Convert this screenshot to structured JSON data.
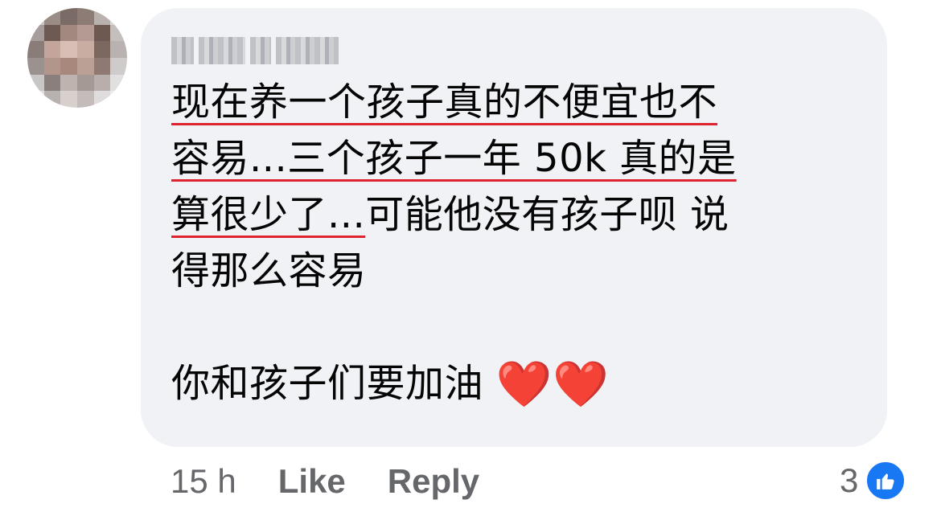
{
  "comment": {
    "lines": [
      "现在养一个孩子真的不便宜也不",
      "容易...三个孩子一年 50k 真的是",
      "算很少了...",
      "可能他没有孩子呗 说",
      "得那么容易",
      "你和孩子们要加油",
      "❤️❤️"
    ]
  },
  "footer": {
    "time": "15 h",
    "like_label": "Like",
    "reply_label": "Reply",
    "reaction_count": "3",
    "reaction_icon": "thumbs-up-icon"
  },
  "colors": {
    "bubble": "#f0f2f5",
    "underline": "#e0242f",
    "meta_text": "#65676b",
    "like_blue": "#1877f2"
  }
}
